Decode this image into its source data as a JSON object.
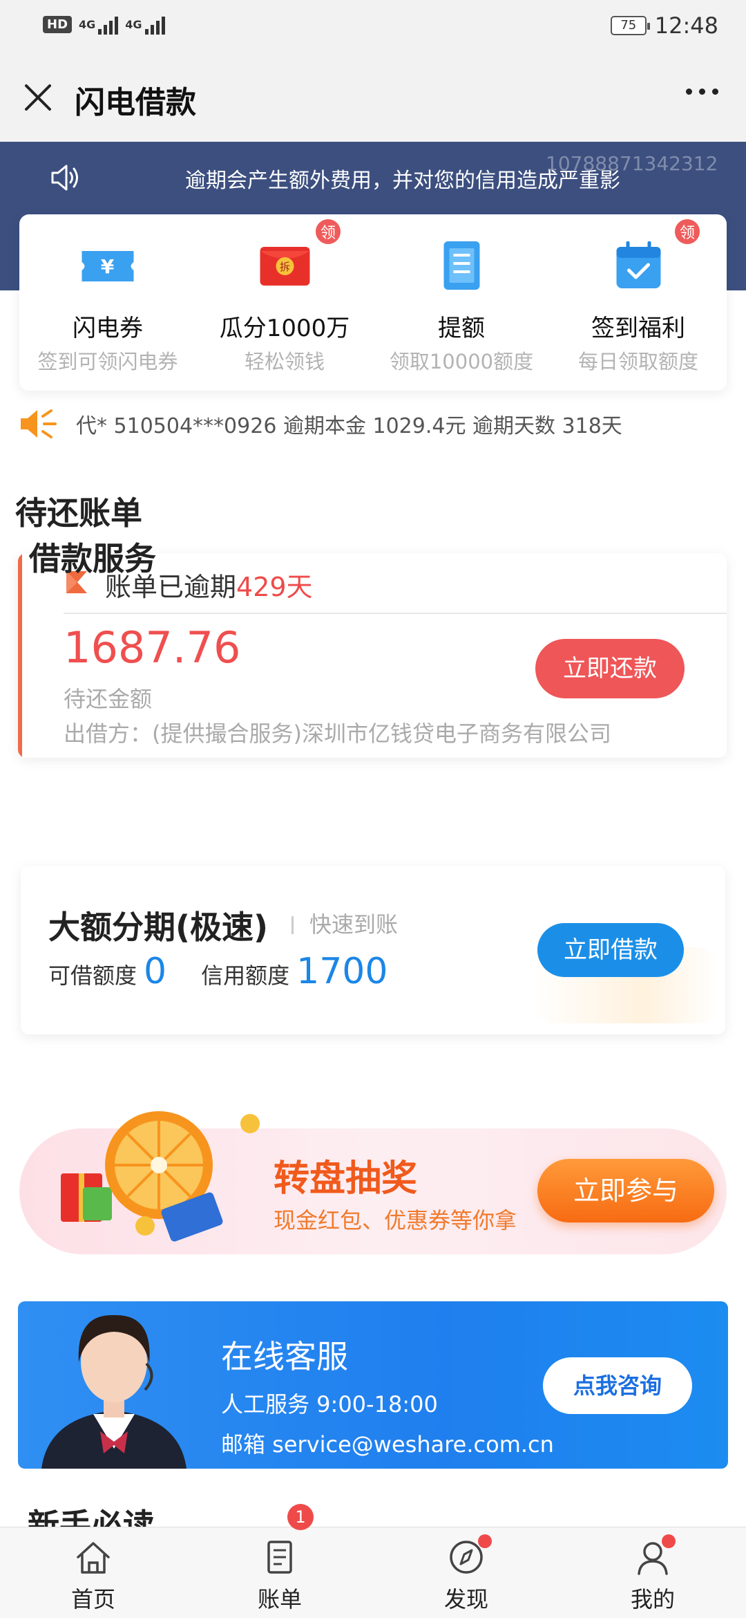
{
  "status_bar": {
    "hd": "HD",
    "sim1": "4G",
    "sim2": "4G",
    "battery": "75",
    "time": "12:48"
  },
  "header": {
    "title": "闪电借款"
  },
  "notice": {
    "text": "逾期会产生额外费用，并对您的信用造成严重影",
    "watermark": "10788871342312"
  },
  "quick_actions": [
    {
      "label": "闪电券",
      "sub": "签到可领闪电券",
      "icon": "ticket-icon"
    },
    {
      "label": "瓜分1000万",
      "sub": "轻松领钱",
      "icon": "red-envelope-icon",
      "badge": "领",
      "icon_text": "拆"
    },
    {
      "label": "提额",
      "sub": "领取10000额度",
      "icon": "document-icon"
    },
    {
      "label": "签到福利",
      "sub": "每日领取额度",
      "icon": "calendar-check-icon",
      "badge": "领"
    }
  ],
  "overdue_ticker": {
    "text": "代* 510504***0926 逾期本金 1029.4元 逾期天数 318天"
  },
  "pending_bill": {
    "section_title": "待还账单",
    "status_prefix": "账单已逾期",
    "overdue_days": "429天",
    "amount": "1687.76",
    "amount_label": "待还金额",
    "lender": "出借方：(提供撮合服务)深圳市亿钱贷电子商务有限公司",
    "repay_button": "立即还款"
  },
  "loan_service": {
    "section_title": "借款服务",
    "product_title": "大额分期(极速)",
    "product_tag": "快速到账",
    "available_label": "可借额度",
    "available_value": "0",
    "credit_label": "信用额度",
    "credit_value": "1700",
    "borrow_button": "立即借款"
  },
  "lottery": {
    "title": "转盘抽奖",
    "subtitle": "现金红包、优惠券等你拿",
    "button": "立即参与"
  },
  "customer_service": {
    "title": "在线客服",
    "hours": "人工服务 9:00-18:00",
    "email": "邮箱 service@weshare.com.cn",
    "button": "点我咨询"
  },
  "newbie": {
    "section_title": "新手必读"
  },
  "tabbar": [
    {
      "label": "首页",
      "icon": "home-icon"
    },
    {
      "label": "账单",
      "icon": "bill-icon",
      "badge": "1"
    },
    {
      "label": "发现",
      "icon": "compass-icon",
      "dot": true
    },
    {
      "label": "我的",
      "icon": "user-icon",
      "dot": true
    }
  ],
  "colors": {
    "banner": "#3c4f7f",
    "danger": "#ef4a4a",
    "primary_blue": "#1b8fe8",
    "orange": "#f76b12"
  }
}
